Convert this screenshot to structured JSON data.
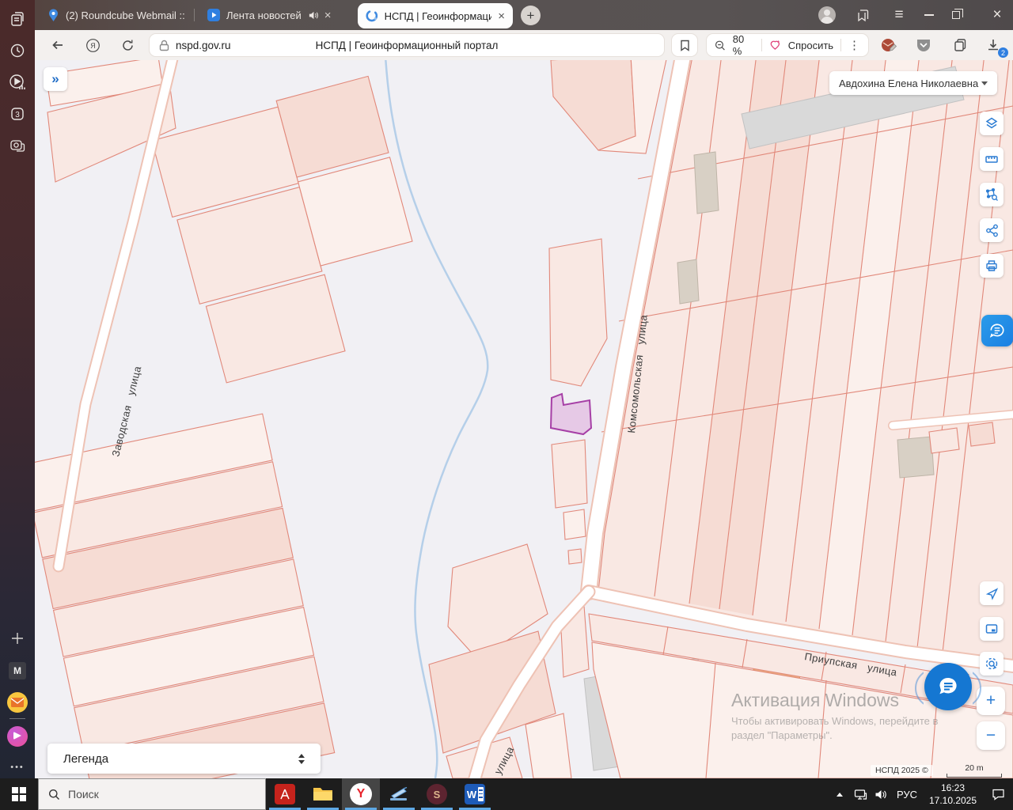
{
  "sidebar": {
    "tab_badge": "3",
    "m_label": "M"
  },
  "tabbar": {
    "tabs": [
      {
        "label": "(2) Roundcube Webmail ::"
      },
      {
        "label": "Лента новостей"
      },
      {
        "label": "НСПД | Геоинформаци"
      }
    ]
  },
  "addressbar": {
    "url": "nspd.gov.ru",
    "page_title": "НСПД | Геоинформационный портал",
    "zoom_level": "80 %",
    "ask_label": "Спросить",
    "download_badge": "2"
  },
  "map": {
    "user_name": "Авдохина Елена Николаевна",
    "legend_label": "Легенда",
    "streets": {
      "zavodskaya": "Заводская улица",
      "komsomolskaya": "Комсомольская улица",
      "priupskaya": "Приупская улица",
      "partial": "улица"
    },
    "watermark": {
      "title": "Активация Windows",
      "line1": "Чтобы активировать Windows, перейдите в",
      "line2": "раздел \"Параметры\"."
    },
    "attribution": "НСПД 2025 ©",
    "scale": "20 m"
  },
  "taskbar": {
    "search_placeholder": "Поиск",
    "lang": "РУС",
    "time": "16:23",
    "date": "17.10.2025"
  },
  "icons": {
    "close": "×",
    "plus": "+",
    "minus": "−",
    "menu": "≡",
    "more_vertical": "⋮",
    "expand": "»",
    "dots": "•••",
    "yandex_letter": "Я",
    "y_letter": "Y",
    "s_letter": "S",
    "w_letter": "W",
    "a_letter": "A"
  }
}
